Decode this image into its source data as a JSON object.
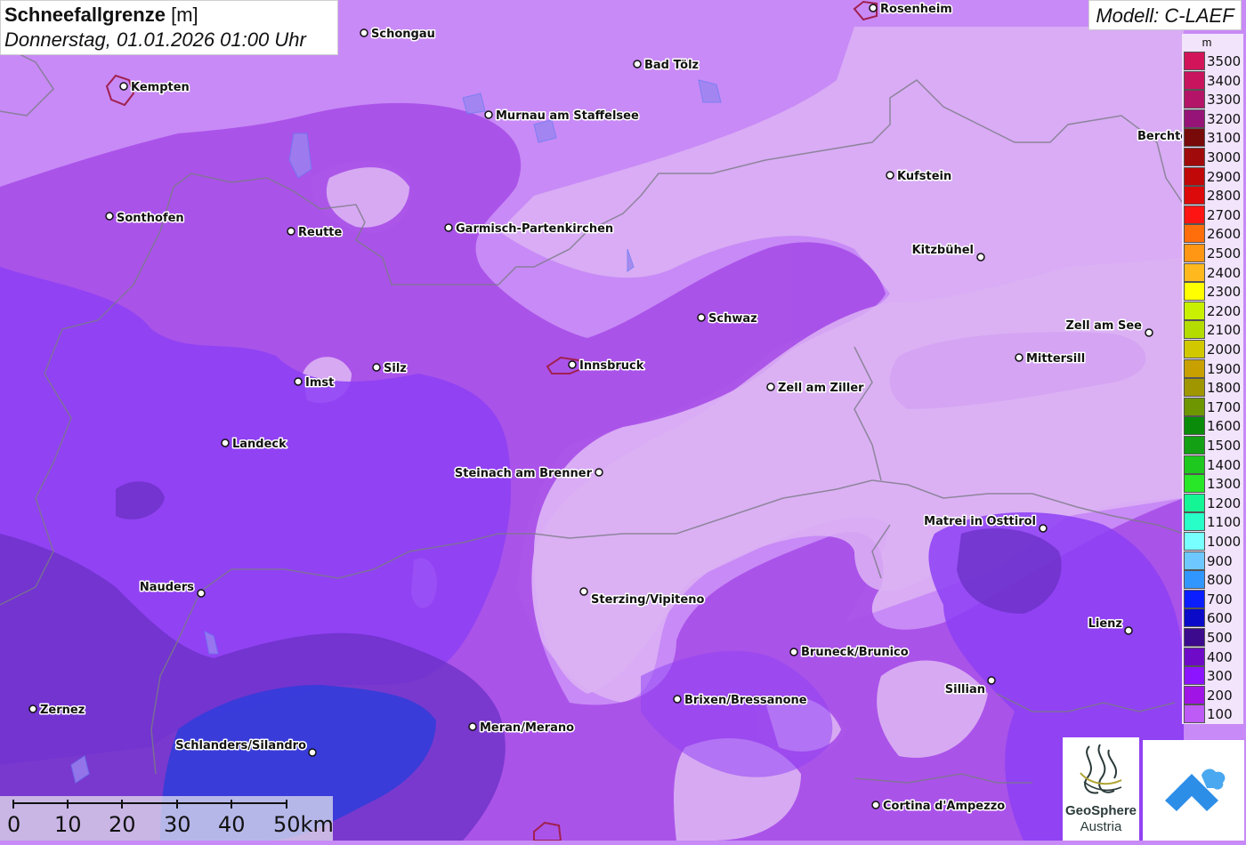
{
  "title": {
    "parameter": "Schneefallgrenze",
    "unit": "[m]",
    "datetime": "Donnerstag, 01.01.2026 01:00 Uhr"
  },
  "model": "Modell: C-LAEF",
  "legend": {
    "unit": "m",
    "entries": [
      {
        "label": "3500",
        "color": "#d2145a"
      },
      {
        "label": "3400",
        "color": "#c8145e"
      },
      {
        "label": "3300",
        "color": "#b41468"
      },
      {
        "label": "3200",
        "color": "#961478"
      },
      {
        "label": "3100",
        "color": "#780a0a"
      },
      {
        "label": "3000",
        "color": "#a00a0a"
      },
      {
        "label": "2900",
        "color": "#c00808"
      },
      {
        "label": "2800",
        "color": "#dc0a0a"
      },
      {
        "label": "2700",
        "color": "#ff1414"
      },
      {
        "label": "2600",
        "color": "#ff6e0a"
      },
      {
        "label": "2500",
        "color": "#ff9614"
      },
      {
        "label": "2400",
        "color": "#ffb91e"
      },
      {
        "label": "2300",
        "color": "#ffff00"
      },
      {
        "label": "2200",
        "color": "#c8f000"
      },
      {
        "label": "2100",
        "color": "#b4dc00"
      },
      {
        "label": "2000",
        "color": "#d2c800"
      },
      {
        "label": "1900",
        "color": "#c8a000"
      },
      {
        "label": "1800",
        "color": "#a09600"
      },
      {
        "label": "1700",
        "color": "#6e9600"
      },
      {
        "label": "1600",
        "color": "#0a8c0a"
      },
      {
        "label": "1500",
        "color": "#14a014"
      },
      {
        "label": "1400",
        "color": "#1ec81e"
      },
      {
        "label": "1300",
        "color": "#28e628"
      },
      {
        "label": "1200",
        "color": "#14f596"
      },
      {
        "label": "1100",
        "color": "#28ffc8"
      },
      {
        "label": "1000",
        "color": "#78ffff"
      },
      {
        "label": "900",
        "color": "#6ec8ff"
      },
      {
        "label": "800",
        "color": "#3296ff"
      },
      {
        "label": "700",
        "color": "#0a1eff"
      },
      {
        "label": "600",
        "color": "#0a0ac8"
      },
      {
        "label": "500",
        "color": "#3c0a8c"
      },
      {
        "label": "400",
        "color": "#6e0ac8"
      },
      {
        "label": "300",
        "color": "#8c14ff"
      },
      {
        "label": "200",
        "color": "#a014e6"
      },
      {
        "label": "100",
        "color": "#be5af5"
      }
    ]
  },
  "cities": [
    {
      "name": "Rosenheim"
    },
    {
      "name": "Schongau"
    },
    {
      "name": "Bad Tölz"
    },
    {
      "name": "Kempten"
    },
    {
      "name": "Murnau am Staffelsee"
    },
    {
      "name": "Berchte"
    },
    {
      "name": "Kufstein"
    },
    {
      "name": "Sonthofen"
    },
    {
      "name": "Reutte"
    },
    {
      "name": "Garmisch-Partenkirchen"
    },
    {
      "name": "Kitzbühel"
    },
    {
      "name": "Schwaz"
    },
    {
      "name": "Zell am See"
    },
    {
      "name": "Mittersill"
    },
    {
      "name": "Innsbruck"
    },
    {
      "name": "Silz"
    },
    {
      "name": "Imst"
    },
    {
      "name": "Zell am Ziller"
    },
    {
      "name": "Landeck"
    },
    {
      "name": "Steinach am Brenner"
    },
    {
      "name": "Matrei in Osttirol"
    },
    {
      "name": "Nauders"
    },
    {
      "name": "Sterzing/Vipiteno"
    },
    {
      "name": "Lienz"
    },
    {
      "name": "Bruneck/Brunico"
    },
    {
      "name": "Sillian"
    },
    {
      "name": "Brixen/Bressanone"
    },
    {
      "name": "Zernez"
    },
    {
      "name": "Meran/Merano"
    },
    {
      "name": "Schlanders/Silandro"
    },
    {
      "name": "Cortina d'Ampezzo"
    }
  ],
  "scale": {
    "labels": [
      "0",
      "10",
      "20",
      "30",
      "40",
      "50km"
    ]
  },
  "logos": {
    "geosphere_line1": "GeoSphere",
    "geosphere_line2": "Austria"
  },
  "colors": {
    "band_100": "#c88af6",
    "band_200": "#a64ce8",
    "band_300": "#8d3ff5",
    "band_400": "#6a30c4",
    "band_600": "#2a3ddc",
    "snow_free_light": "#e0b8f2"
  }
}
